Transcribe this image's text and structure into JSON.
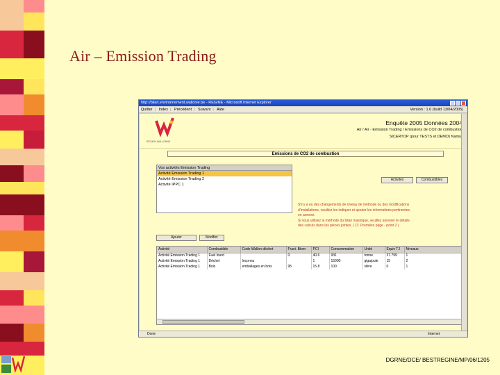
{
  "slide": {
    "title": "Air – Emission Trading",
    "footer": "DGRNE/DCE/ BESTREGINE/MP/06/1205"
  },
  "colors": {
    "background": "#fffcc8",
    "title": "#8b1a1a",
    "stripe_red": "#d7263d",
    "stripe_dark": "#8a0f1e",
    "stripe_yellow": "#ffef5f",
    "stripe_orange": "#f08c2d",
    "warning": "#c0392b",
    "selection": "#f5c542"
  },
  "browser": {
    "title": "http://bilan.environnement.wallonie.be - REGINE - Microsoft Internet Explorer",
    "menu": [
      "Quitter",
      "Index",
      "Précédent",
      "Suivant",
      "Aide"
    ],
    "version": "Version : 1.6 (build 13/04/2005)",
    "status_left": "Done",
    "status_right": "Internet"
  },
  "header": {
    "logo_caption": "RÉGION WALLONNE",
    "survey": "Enquête 2005 Données 2004",
    "breadcrumb": "Air / Air - Emission Trading / Emissions de CO2 de combustion",
    "company": "SICERTOP (pour TESTS et DEMO) Namur"
  },
  "section": {
    "title": "Emissions de CO2 de combustion"
  },
  "activities": {
    "header": "Vos activités Emission Trading",
    "items": [
      "Activité Emission Trading 1",
      "Activité Emission Trading 2",
      "Activité IPPC 1"
    ],
    "selected_index": 0
  },
  "buttons": {
    "activities": "Activités",
    "fuels": "Combustibles",
    "add": "Ajouter",
    "modify": "Modifier"
  },
  "warning": {
    "lines": [
      "S'il y a eu des changements de niveau de méthode ou des modifications",
      "d'installations, veuillez les indiquer et ajouter les informations pertinentes",
      "en annexe.",
      "Si vous utilisez la méthode du bilan massique, veuillez annexer le détails",
      "des calculs dans les pièces jointes. ( Cf. Première page - point 2 )"
    ]
  },
  "table": {
    "columns": [
      "Activité",
      "Combustible",
      "Code Wallon déchet",
      "Fract. Biom",
      "PCI",
      "Consommation",
      "Unité",
      "Equiv TJ",
      "Niveaux"
    ],
    "rows": [
      [
        "Activité Emission Trading 1",
        "Fuel lourd",
        "",
        "0",
        "40.6",
        "931",
        "tonne",
        "37.799",
        "1"
      ],
      [
        "Activité Emission Trading 1",
        "Déchet",
        "Inconnu",
        "",
        "1",
        "15000",
        "gigajoule",
        "15",
        "2"
      ],
      [
        "Activité Emission Trading 1",
        "Bois",
        "emballages en bois",
        "95",
        "15.8",
        "100",
        "stère",
        "0",
        "1"
      ]
    ]
  }
}
